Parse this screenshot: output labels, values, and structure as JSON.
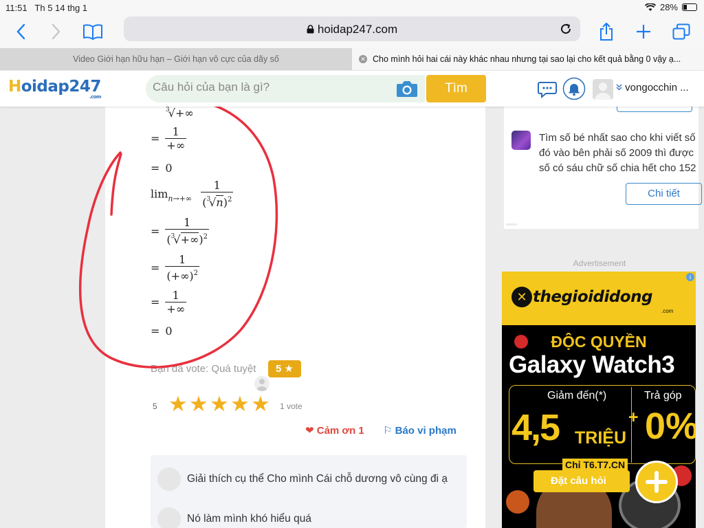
{
  "status": {
    "time": "11:51",
    "date": "Th 5 14 thg 1",
    "battery": "28%",
    "battery_level": 0.28
  },
  "browser": {
    "url": "hoidap247.com"
  },
  "tabs": [
    {
      "label": "Video Giới hạn hữu hạn – Giới hạn vô cực của dãy số",
      "active": false
    },
    {
      "label": "Cho mình hỏi hai cái này khác nhau nhưng tại sao lại cho kết quả bằng 0 vậy ạ...",
      "active": true
    }
  ],
  "header": {
    "logo": "Hoidap247",
    "logo_suffix": ".com",
    "search_placeholder": "Câu hỏi của bạn là gì?",
    "search_button": "Tìm",
    "username": "vongocchin ..."
  },
  "answer": {
    "math": {
      "eq": "=",
      "one": "1",
      "zero": "0",
      "inf": "+∞",
      "lim": "lim",
      "lim_sub": "n→+∞",
      "root_index": "3",
      "var_n": "n",
      "exp2": "2"
    },
    "vote_text": "Bạn đã vote: Quá tuyệt",
    "vote_badge": "5 ★",
    "rating": "5",
    "star_rating": 5,
    "vote_count": "1 vote",
    "thanks": "Cảm ơn 1",
    "report": "Báo vi phạm"
  },
  "comments": [
    {
      "text": "Giải thích cụ thể Cho mình Cái chỗ dương vô cùng đi ạ"
    },
    {
      "text": "Nó làm mình khó hiểu quá"
    }
  ],
  "sidebar": {
    "question": "Tìm số bé nhất sao cho khi viết số đó vào bên phải số 2009 thì được số có sáu chữ số chia hết cho 152",
    "detail_button": "Chi tiết",
    "ad_label": "Advertisement",
    "ad": {
      "brand": "thegioididong",
      "brand_suffix": ".com",
      "exclusive": "ĐỘC QUYỀN",
      "product": "Galaxy Watch3",
      "discount_label": "Giảm đến(*)",
      "installment_label": "Trả góp",
      "discount_value": "4,5",
      "discount_unit": "TRIỆU",
      "plus": "+",
      "installment_value": "0%",
      "days": "Chỉ T6.T7.CN"
    }
  },
  "ask_button": "Đặt câu hỏi",
  "colors": {
    "accent": "#f0b823",
    "link": "#2a79c9",
    "annotation": "#e8303f"
  }
}
